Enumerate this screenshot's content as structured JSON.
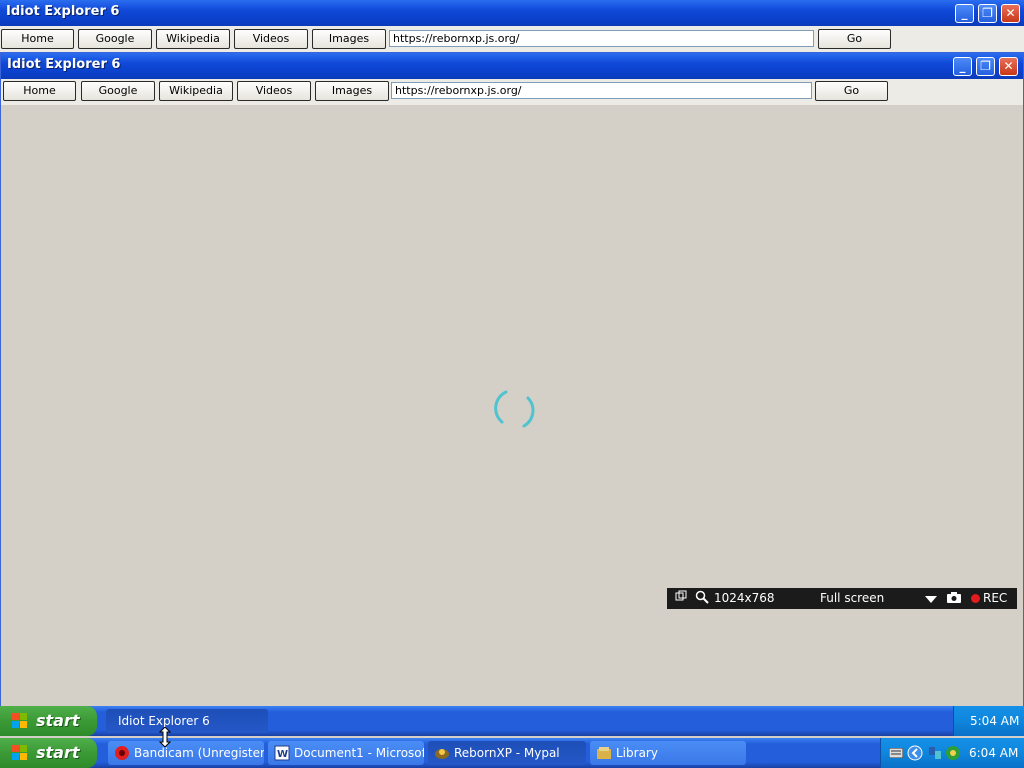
{
  "outer_window": {
    "title": "Idiot Explorer 6",
    "buttons": {
      "minimize": "_",
      "restore": "❐",
      "close": "✕"
    },
    "toolbar": {
      "home": "Home",
      "google": "Google",
      "wikipedia": "Wikipedia",
      "videos": "Videos",
      "images": "Images",
      "url": "https://rebornxp.js.org/",
      "go": "Go"
    }
  },
  "inner_window": {
    "title": "Idiot Explorer 6",
    "buttons": {
      "minimize": "_",
      "restore": "❐",
      "close": "✕"
    },
    "toolbar": {
      "home": "Home",
      "google": "Google",
      "wikipedia": "Wikipedia",
      "videos": "Videos",
      "images": "Images",
      "url": "https://rebornxp.js.org/",
      "go": "Go"
    }
  },
  "recorder_bar": {
    "resolution": "1024x768",
    "mode": "Full screen",
    "rec": "REC"
  },
  "inner_taskbar": {
    "start": "start",
    "task": "Idiot Explorer 6",
    "clock": "5:04 AM"
  },
  "outer_taskbar": {
    "start": "start",
    "tasks": [
      {
        "label": "Bandicam (Unregister...",
        "icon": "bandicam-icon"
      },
      {
        "label": "Document1 - Microsof...",
        "icon": "word-icon"
      },
      {
        "label": "RebornXP - Mypal",
        "icon": "mypal-icon"
      },
      {
        "label": "Library",
        "icon": "library-icon"
      }
    ],
    "clock": "6:04 AM"
  }
}
